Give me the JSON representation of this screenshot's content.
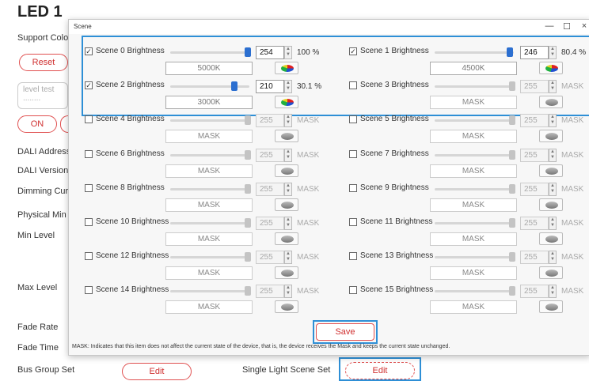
{
  "background": {
    "title": "LED 1",
    "labels": {
      "support_colour": "Support Colou",
      "level_test": "level test",
      "level_test_value": "........",
      "dali_address": "DALI Address",
      "dali_version": "DALI Version",
      "dimming_curve": "Dimming Cur",
      "physical_min": "Physical Min l",
      "min_level": "Min Level",
      "max_level": "Max Level",
      "fade_rate": "Fade Rate",
      "fade_time": "Fade Time",
      "bus_group_set": "Bus Group Set",
      "single_light_scene_set": "Single Light Scene Set"
    },
    "buttons": {
      "reset": "Reset",
      "on": "ON",
      "bus_group_edit": "Edit",
      "scene_edit": "Edit"
    }
  },
  "dialog": {
    "title": "Scene",
    "controls": {
      "minimize": "—",
      "maximize": "☐",
      "close": "×"
    },
    "brightness_word": "Brightness",
    "scenes": [
      {
        "name": "Scene 0",
        "checked": true,
        "value": "254",
        "pct": "100 %",
        "cct": "5000K",
        "level": 1.0
      },
      {
        "name": "Scene 1",
        "checked": true,
        "value": "246",
        "pct": "80.4 %",
        "cct": "4500K",
        "level": 0.97
      },
      {
        "name": "Scene 2",
        "checked": true,
        "value": "210",
        "pct": "30.1 %",
        "cct": "3000K",
        "level": 0.83
      },
      {
        "name": "Scene 3",
        "checked": false,
        "value": "255",
        "pct": "MASK",
        "cct": "MASK",
        "level": 1.0
      },
      {
        "name": "Scene 4",
        "checked": false,
        "value": "255",
        "pct": "MASK",
        "cct": "MASK",
        "level": 1.0
      },
      {
        "name": "Scene 5",
        "checked": false,
        "value": "255",
        "pct": "MASK",
        "cct": "MASK",
        "level": 1.0
      },
      {
        "name": "Scene 6",
        "checked": false,
        "value": "255",
        "pct": "MASK",
        "cct": "MASK",
        "level": 1.0
      },
      {
        "name": "Scene 7",
        "checked": false,
        "value": "255",
        "pct": "MASK",
        "cct": "MASK",
        "level": 1.0
      },
      {
        "name": "Scene 8",
        "checked": false,
        "value": "255",
        "pct": "MASK",
        "cct": "MASK",
        "level": 1.0
      },
      {
        "name": "Scene 9",
        "checked": false,
        "value": "255",
        "pct": "MASK",
        "cct": "MASK",
        "level": 1.0
      },
      {
        "name": "Scene 10",
        "checked": false,
        "value": "255",
        "pct": "MASK",
        "cct": "MASK",
        "level": 1.0
      },
      {
        "name": "Scene 11",
        "checked": false,
        "value": "255",
        "pct": "MASK",
        "cct": "MASK",
        "level": 1.0
      },
      {
        "name": "Scene 12",
        "checked": false,
        "value": "255",
        "pct": "MASK",
        "cct": "MASK",
        "level": 1.0
      },
      {
        "name": "Scene 13",
        "checked": false,
        "value": "255",
        "pct": "MASK",
        "cct": "MASK",
        "level": 1.0
      },
      {
        "name": "Scene 14",
        "checked": false,
        "value": "255",
        "pct": "MASK",
        "cct": "MASK",
        "level": 1.0
      },
      {
        "name": "Scene 15",
        "checked": false,
        "value": "255",
        "pct": "MASK",
        "cct": "MASK",
        "level": 1.0
      }
    ],
    "save_label": "Save",
    "mask_note": "MASK: Indicates that this item does not affect the current state of the device, that is, the device receives the Mask and keeps the current state unchanged."
  },
  "colors": {
    "accent_blue": "#2e8fd6",
    "slider_blue": "#2c6fd0",
    "button_red": "#d03030"
  },
  "icons": {
    "color_picker": "color-wheel-icon",
    "checkbox": "checkbox-icon"
  }
}
